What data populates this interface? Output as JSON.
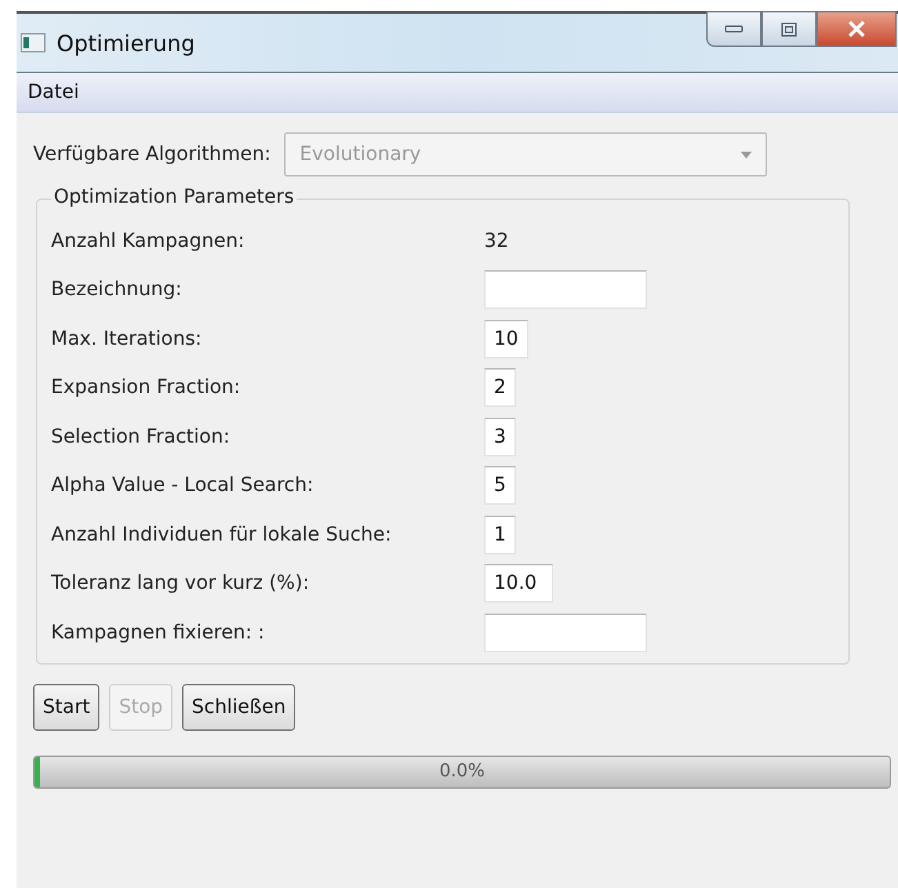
{
  "window": {
    "title": "Optimierung"
  },
  "menu": [
    {
      "label": "Datei"
    }
  ],
  "algorithm": {
    "label": "Verfügbare Algorithmen:",
    "value": "Evolutionary",
    "disabled": true
  },
  "group": {
    "title": "Optimization Parameters",
    "params": [
      {
        "label": "Anzahl Kampagnen:",
        "kind": "text",
        "value": "32"
      },
      {
        "label": "Bezeichnung:",
        "kind": "field"
      },
      {
        "label": "Max. Iterations:",
        "kind": "field",
        "value": "10"
      },
      {
        "label": "Expansion Fraction:",
        "kind": "field",
        "value": "2"
      },
      {
        "label": "Selection Fraction:",
        "kind": "field",
        "value": "3"
      },
      {
        "label": "Alpha Value - Local Search:",
        "kind": "field",
        "value": "5"
      },
      {
        "label": "Anzahl Individuen für lokale Suche:",
        "kind": "field",
        "value": "1"
      },
      {
        "label": "Toleranz lang vor kurz (%):",
        "kind": "field",
        "value": "10.0"
      },
      {
        "label": "Kampagnen fixieren: :",
        "kind": "field"
      }
    ]
  },
  "buttons": [
    {
      "label": "Start",
      "disabled": false
    },
    {
      "label": "Stop",
      "disabled": true
    },
    {
      "label": "Schließen",
      "disabled": false
    }
  ],
  "progress": {
    "level": 0,
    "label": "0.0%"
  }
}
